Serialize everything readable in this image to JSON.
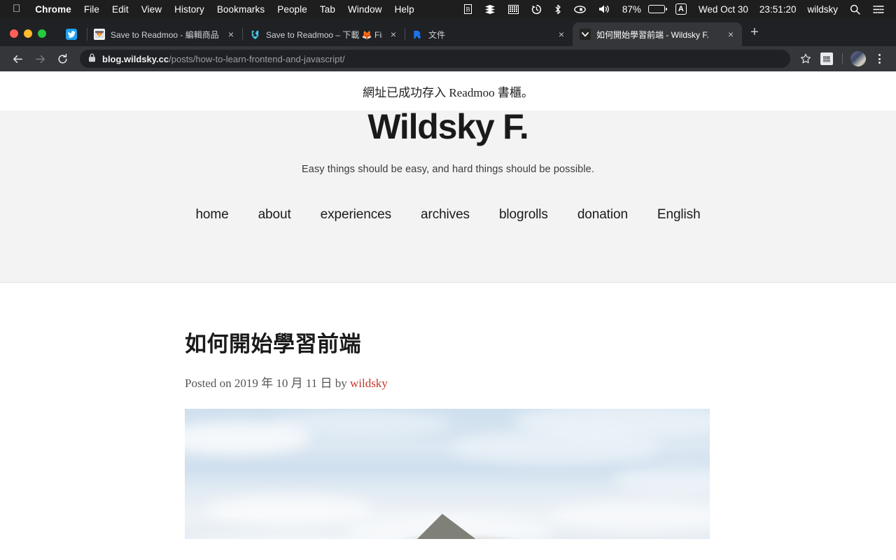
{
  "menubar": {
    "apple_icon": "apple-logo",
    "items": [
      {
        "label": "Chrome",
        "bold": true
      },
      {
        "label": "File",
        "bold": false
      },
      {
        "label": "Edit",
        "bold": false
      },
      {
        "label": "View",
        "bold": false
      },
      {
        "label": "History",
        "bold": false
      },
      {
        "label": "Bookmarks",
        "bold": false
      },
      {
        "label": "People",
        "bold": false
      },
      {
        "label": "Tab",
        "bold": false
      },
      {
        "label": "Window",
        "bold": false
      },
      {
        "label": "Help",
        "bold": false
      }
    ],
    "status_icons": [
      {
        "name": "bartender-icon",
        "glyph": "B"
      },
      {
        "name": "stack-lines-icon",
        "glyph": "≡"
      },
      {
        "name": "grid-icon",
        "glyph": "▒"
      },
      {
        "name": "time-machine-icon",
        "glyph": "◴"
      },
      {
        "name": "bluetooth-icon",
        "glyph": "ᛦ"
      },
      {
        "name": "privacy-eye-icon",
        "glyph": "ʘ"
      },
      {
        "name": "volume-icon",
        "glyph": "🔊"
      }
    ],
    "battery_percent": "87%",
    "input_source": "A",
    "date": "Wed Oct 30",
    "time": "23:51:20",
    "user": "wildsky",
    "search_icon": "spotlight-search-icon",
    "control_center_icon": "control-center-icon"
  },
  "browser": {
    "tabs": [
      {
        "title": "",
        "favicon": "twitter-favicon",
        "pinned": true,
        "active": false,
        "close": ""
      },
      {
        "title": "Save to Readmoo - 編輯商品",
        "favicon": "chrome-web-store-favicon",
        "pinned": false,
        "active": false,
        "close": "×"
      },
      {
        "title": "Save to Readmoo – 下載 🦊 Fir",
        "favicon": "firefox-addons-favicon",
        "pinned": false,
        "active": false,
        "close": "×"
      },
      {
        "title": "文件",
        "favicon": "documents-favicon",
        "pinned": false,
        "active": false,
        "close": "×"
      },
      {
        "title": "如何開始學習前端 - Wildsky F.",
        "favicon": "wildsky-favicon",
        "pinned": false,
        "active": true,
        "close": "×"
      }
    ],
    "new_tab_label": "+",
    "toolbar": {
      "back_icon": "←",
      "forward_icon": "→",
      "reload_icon": "↻",
      "lock_icon": "🔒",
      "url_host": "blog.wildsky.cc",
      "url_path": "/posts/how-to-learn-frontend-and-javascript/",
      "bookmark_star_icon": "☆",
      "extension_icon": "readmoo-extension-icon",
      "profile_avatar": "profile-avatar",
      "menu_icon": "chrome-menu-icon"
    }
  },
  "page": {
    "notice": "網址已成功存入 Readmoo 書櫃。",
    "site_title": "Wildsky F.",
    "tagline": "Easy things should be easy, and hard things should be possible.",
    "nav": [
      {
        "label": "home"
      },
      {
        "label": "about"
      },
      {
        "label": "experiences"
      },
      {
        "label": "archives"
      },
      {
        "label": "blogrolls"
      },
      {
        "label": "donation"
      },
      {
        "label": "English"
      }
    ],
    "post": {
      "title": "如何開始學習前端",
      "meta_prefix": "Posted on 2019 年 10 月 11 日 by ",
      "author": "wildsky",
      "featured_image_alt": "mountain-peak-under-cloudy-sky"
    }
  },
  "colors": {
    "menubar_bg": "#1e1e1e",
    "tabstrip_bg": "#202124",
    "toolbar_bg": "#35363a",
    "header_bg": "#f3f3f3",
    "author_link": "#c0392b",
    "accent_twitter": "#1da1f2"
  }
}
